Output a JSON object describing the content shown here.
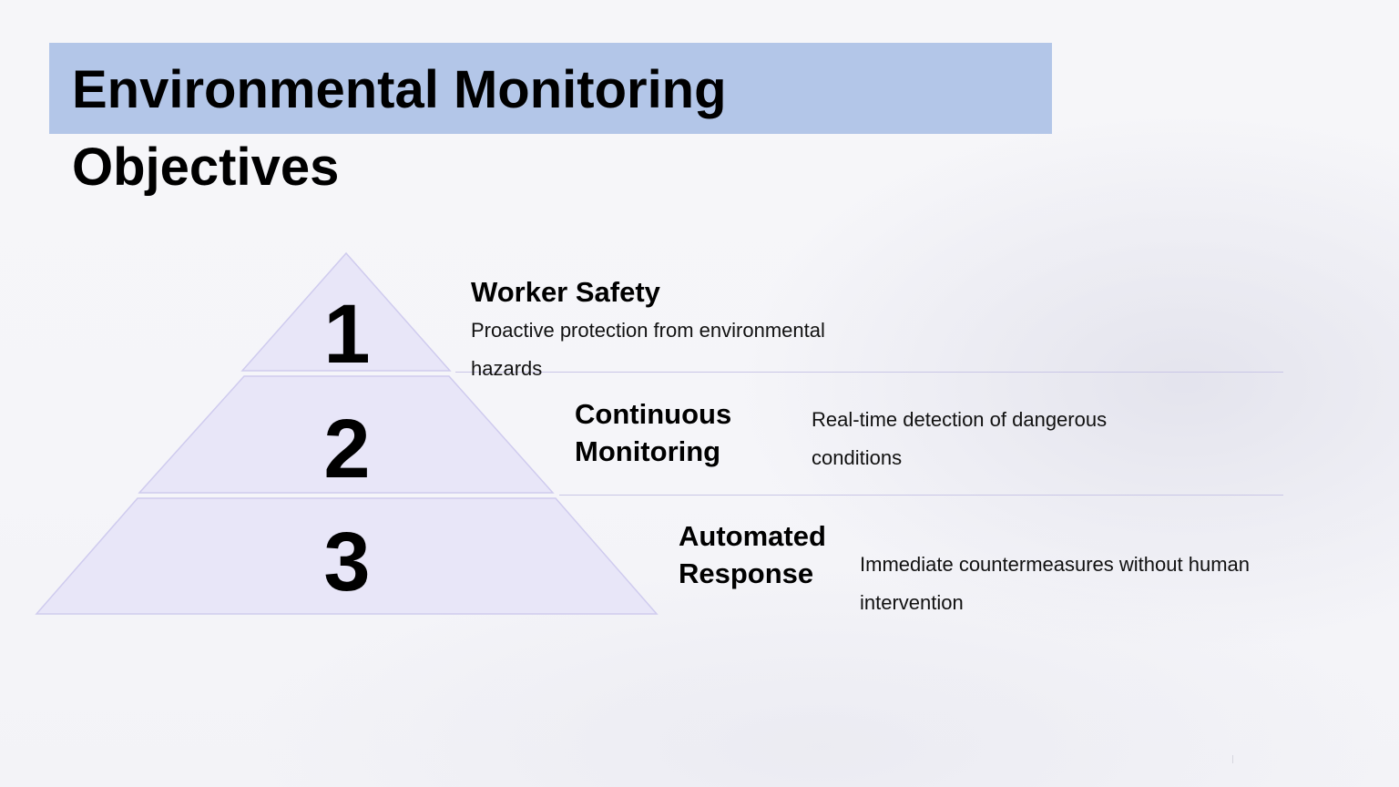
{
  "title": {
    "line1": "Environmental Monitoring",
    "line2": "Objectives"
  },
  "colors": {
    "title_band": "#b3c6e8",
    "tier_fill": "#e8e6f8",
    "tier_stroke": "#cfcbee",
    "divider": "#c9c6e6"
  },
  "tiers": [
    {
      "number": "1",
      "heading": "Worker Safety",
      "description": "Proactive protection from environmental hazards"
    },
    {
      "number": "2",
      "heading": "Continuous Monitoring",
      "description": "Real-time detection of dangerous conditions"
    },
    {
      "number": "3",
      "heading": "Automated Response",
      "description": "Immediate countermeasures without human intervention"
    }
  ]
}
